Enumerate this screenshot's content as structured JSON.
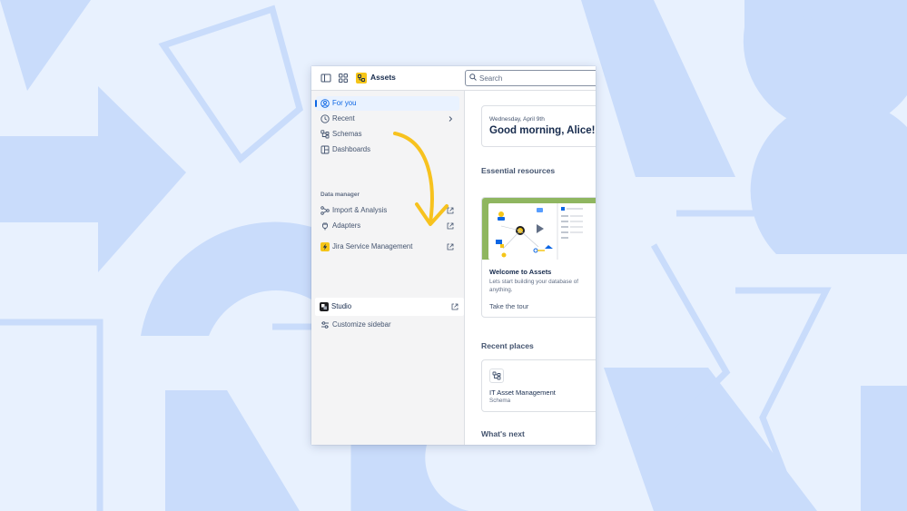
{
  "header": {
    "app_title": "Assets",
    "search_placeholder": "Search",
    "brand_color": "#f5c518"
  },
  "sidebar": {
    "items": [
      {
        "label": "For you",
        "icon": "person-circle-icon",
        "state": "active"
      },
      {
        "label": "Recent",
        "icon": "clock-icon",
        "trailing": "chevron-right-icon"
      },
      {
        "label": "Schemas",
        "icon": "hierarchy-icon"
      },
      {
        "label": "Dashboards",
        "icon": "dashboard-icon"
      }
    ],
    "section_header": "Data manager",
    "data_manager_items": [
      {
        "label": "Import & Analysis",
        "icon": "import-icon",
        "trailing": "external-link-icon"
      },
      {
        "label": "Adapters",
        "icon": "plug-icon",
        "trailing": "external-link-icon"
      },
      {
        "label": "Jira Service Management",
        "icon": "jira-service-management-icon",
        "trailing": "external-link-icon"
      },
      {
        "label": "Studio",
        "icon": "studio-icon",
        "trailing": "external-link-icon",
        "state": "highlighted"
      }
    ],
    "customize": {
      "label": "Customize sidebar",
      "icon": "sliders-icon"
    }
  },
  "main": {
    "date": "Wednesday, April 9th",
    "greeting": "Good morning, Alice!",
    "essential_resources_title": "Essential resources",
    "welcome_card": {
      "title": "Welcome to Assets",
      "description": "Lets start building your database of anything.",
      "link": "Take the tour"
    },
    "recent_places_title": "Recent places",
    "recent_place": {
      "name": "IT Asset Management",
      "type": "Schema"
    },
    "whats_next_title": "What's next"
  },
  "colors": {
    "accent": "#0c66e4",
    "background": "#e8f1fe",
    "annotation_arrow": "#f7c21e",
    "illustration_green": "#8fb660"
  }
}
